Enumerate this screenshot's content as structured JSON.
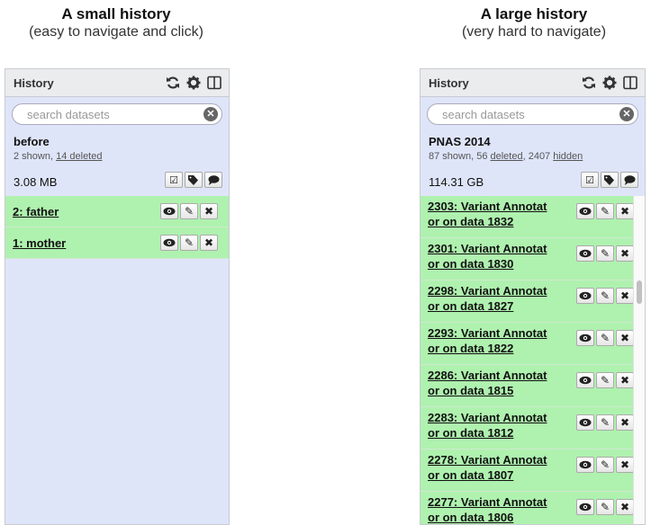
{
  "captions": {
    "left": {
      "title": "A small history",
      "subtitle": "(easy to navigate and click)"
    },
    "right": {
      "title": "A large history",
      "subtitle": "(very hard to navigate)"
    }
  },
  "left_panel": {
    "header_title": "History",
    "search_placeholder": "search datasets",
    "history_name": "before",
    "summary": {
      "shown": "2 shown, ",
      "deleted": "14 deleted"
    },
    "size": "3.08 MB",
    "datasets": [
      {
        "name": "2: father"
      },
      {
        "name": "1: mother"
      }
    ]
  },
  "right_panel": {
    "header_title": "History",
    "search_placeholder": "search datasets",
    "history_name": "PNAS 2014",
    "summary": {
      "shown": "87 shown, 56 ",
      "deleted": "deleted",
      "sep": ", 2407 ",
      "hidden": "hidden"
    },
    "size": "114.31 GB",
    "datasets": [
      {
        "line1": "2303: Variant Annotat",
        "line2": "or on data 1832"
      },
      {
        "line1": "2301: Variant Annotat",
        "line2": "or on data 1830"
      },
      {
        "line1": "2298: Variant Annotat",
        "line2": "or on data 1827"
      },
      {
        "line1": "2293: Variant Annotat",
        "line2": "or on data 1822"
      },
      {
        "line1": "2286: Variant Annotat",
        "line2": "or on data 1815"
      },
      {
        "line1": "2283: Variant Annotat",
        "line2": "or on data 1812"
      },
      {
        "line1": "2278: Variant Annotat",
        "line2": "or on data 1807"
      },
      {
        "line1": "2277: Variant Annotat",
        "line2": "or on data 1806"
      }
    ]
  },
  "icons": {
    "header": [
      "refresh-icon",
      "gear-icon",
      "columns-icon"
    ],
    "history_actions": [
      "checkbox-icon",
      "tags-icon",
      "comment-icon"
    ],
    "dataset_actions": [
      "eye-icon",
      "pencil-icon",
      "close-icon"
    ]
  },
  "colors": {
    "panel_bg": "#dfe5f9",
    "dataset_ok": "#aff1af",
    "header_bg": "#ebecee"
  }
}
